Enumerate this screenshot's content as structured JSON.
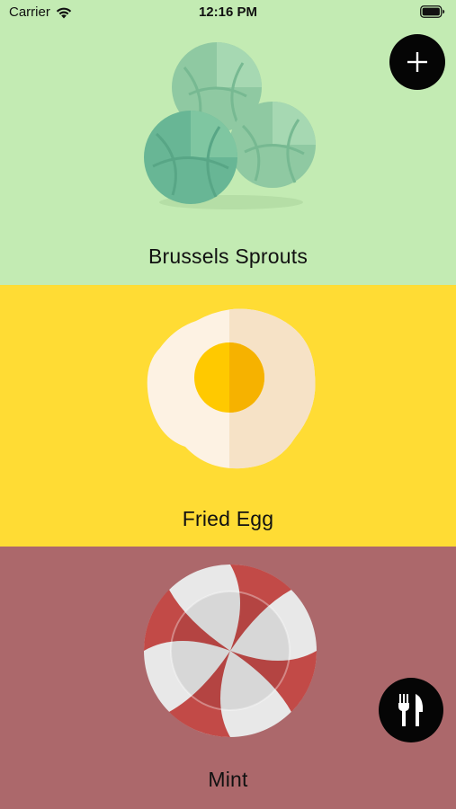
{
  "status_bar": {
    "carrier": "Carrier",
    "time": "12:16 PM",
    "wifi_icon": "wifi-icon",
    "battery_icon": "battery-icon"
  },
  "actions": {
    "add_icon": "plus-icon",
    "utensils_icon": "fork-knife-icon"
  },
  "foods": [
    {
      "name": "Brussels Sprouts",
      "background": "#c3ebb3",
      "icon": "brussels-sprouts-illustration"
    },
    {
      "name": "Fried Egg",
      "background": "#ffdc34",
      "icon": "fried-egg-illustration"
    },
    {
      "name": "Mint",
      "background": "#ac686b",
      "icon": "peppermint-candy-illustration"
    }
  ]
}
